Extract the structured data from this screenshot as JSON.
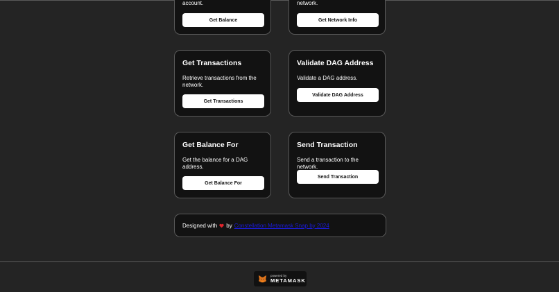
{
  "cards": [
    {
      "title": "",
      "desc": "account.",
      "button": "Get Balance"
    },
    {
      "title": "",
      "desc": "network.",
      "button": "Get Network Info"
    },
    {
      "title": "Get Transactions",
      "desc": "Retrieve transactions from the network.",
      "button": "Get Transactions"
    },
    {
      "title": "Validate DAG Address",
      "desc": "Validate a DAG address.",
      "button": "Validate DAG Address"
    },
    {
      "title": "Get Balance For",
      "desc": "Get the balance for a DAG address.",
      "button": "Get Balance For"
    },
    {
      "title": "Send Transaction",
      "desc": "Send a transaction to the network.",
      "button": "Send Transaction"
    }
  ],
  "footer": {
    "prefix": "Designed with",
    "heart_icon": "heart-icon",
    "by": "by",
    "link_text": "Constellation Metamask Snap by 2024"
  },
  "badge": {
    "powered_by": "powered by",
    "brand": "METAMASK",
    "icon": "metamask-fox-icon"
  },
  "colors": {
    "background": "#242424",
    "card": "#121212",
    "button": "#ffffff",
    "link": "#1b1bd6"
  }
}
